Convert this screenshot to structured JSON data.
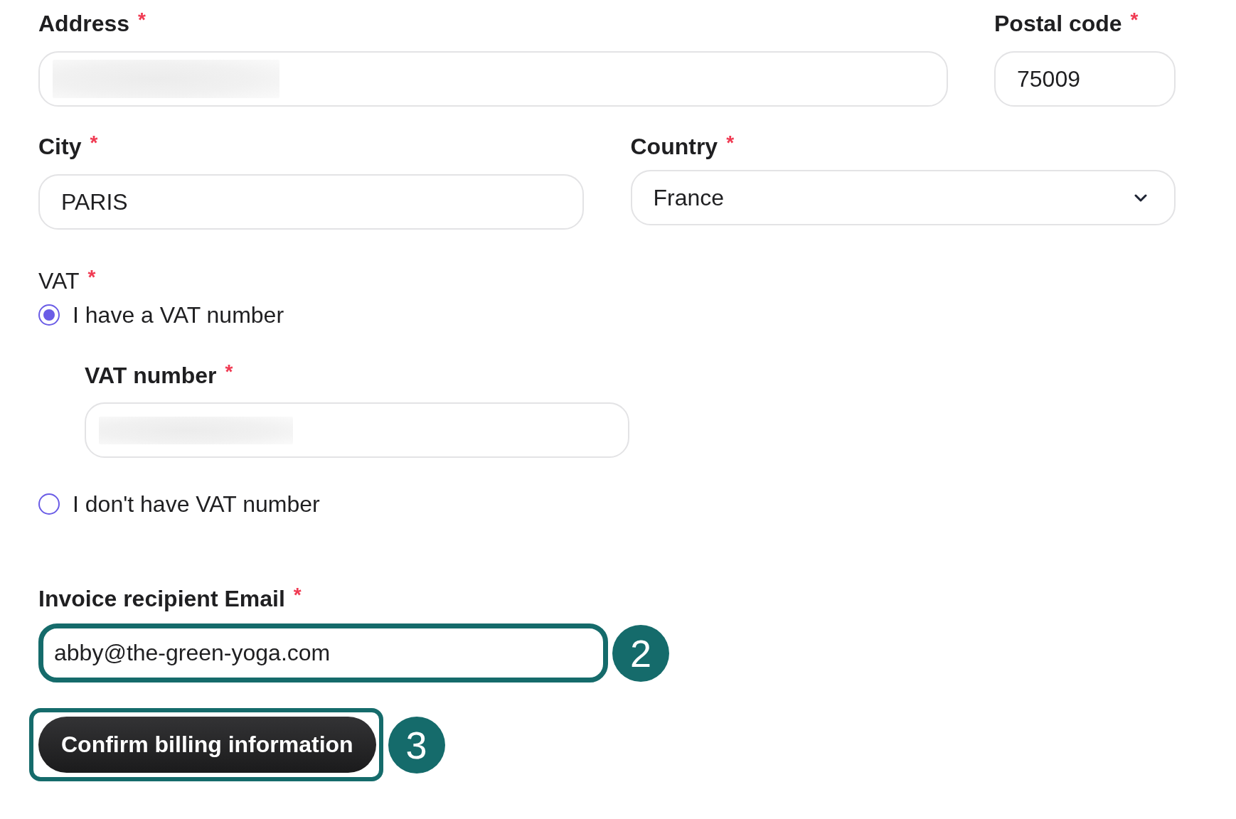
{
  "address": {
    "label": "Address",
    "required_mark": "*",
    "value_blurred": true
  },
  "postal_code": {
    "label": "Postal code",
    "required_mark": "*",
    "value": "75009"
  },
  "city": {
    "label": "City",
    "required_mark": "*",
    "value": "PARIS"
  },
  "country": {
    "label": "Country",
    "required_mark": "*",
    "value": "France"
  },
  "vat": {
    "label": "VAT",
    "required_mark": "*",
    "options": [
      {
        "label": "I have a VAT number",
        "selected": true,
        "field": {
          "label": "VAT number",
          "required_mark": "*",
          "value_blurred": true
        }
      },
      {
        "label": "I don't have VAT number",
        "selected": false
      }
    ]
  },
  "invoice_email": {
    "label": "Invoice recipient Email",
    "required_mark": "*",
    "value": "abby@the-green-yoga.com",
    "highlighted": true,
    "step_badge": "2"
  },
  "confirm_button": {
    "label": "Confirm billing information",
    "highlighted": true,
    "step_badge": "3"
  }
}
